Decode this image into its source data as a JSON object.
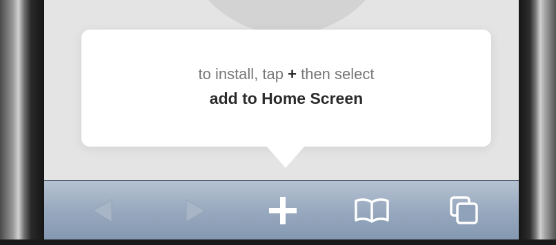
{
  "tooltip": {
    "line1_prefix": "to install, tap ",
    "line1_plus": "+",
    "line1_suffix": " then select",
    "line2": "add to Home Screen"
  },
  "toolbar": {
    "buttons": [
      {
        "icon": "back-arrow-icon",
        "enabled": false
      },
      {
        "icon": "forward-arrow-icon",
        "enabled": false
      },
      {
        "icon": "plus-icon",
        "enabled": true
      },
      {
        "icon": "bookmarks-book-icon",
        "enabled": true
      },
      {
        "icon": "pages-icon",
        "enabled": true
      }
    ]
  },
  "colors": {
    "toolbar_top": "#b5c2d1",
    "toolbar_bottom": "#8398b1",
    "bubble_bg": "#ffffff",
    "screen_bg": "#e4e4e4"
  }
}
